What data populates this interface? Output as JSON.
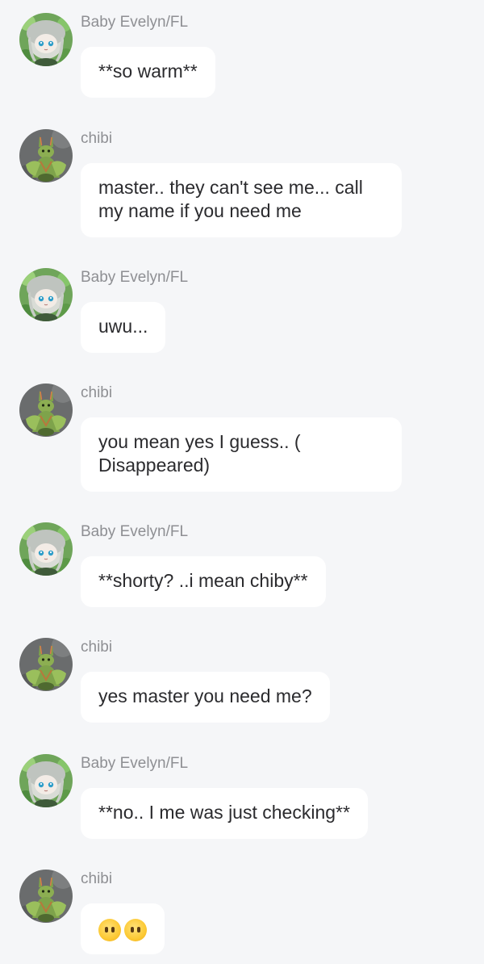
{
  "messages": [
    {
      "sender": "Baby Evelyn/FL",
      "avatar": "girl-avatar-icon",
      "text": "**so warm**"
    },
    {
      "sender": "chibi",
      "avatar": "bunny-avatar-icon",
      "text": "master.. they can't see me... call my name if you need me"
    },
    {
      "sender": "Baby Evelyn/FL",
      "avatar": "girl-avatar-icon",
      "text": "uwu..."
    },
    {
      "sender": "chibi",
      "avatar": "bunny-avatar-icon",
      "text": "you mean yes I guess.. ( Disappeared)"
    },
    {
      "sender": "Baby Evelyn/FL",
      "avatar": "girl-avatar-icon",
      "text": "**shorty? ..i mean chiby**"
    },
    {
      "sender": "chibi",
      "avatar": "bunny-avatar-icon",
      "text": "yes master you need me?"
    },
    {
      "sender": "Baby Evelyn/FL",
      "avatar": "girl-avatar-icon",
      "text": "**no.. I me was just checking**"
    },
    {
      "sender": "chibi",
      "avatar": "bunny-avatar-icon",
      "text": "😶😶"
    }
  ],
  "colors": {
    "background": "#f5f6f8",
    "bubble": "#ffffff",
    "sender_name": "#8e8f93",
    "message_text": "#2b2b2e"
  }
}
